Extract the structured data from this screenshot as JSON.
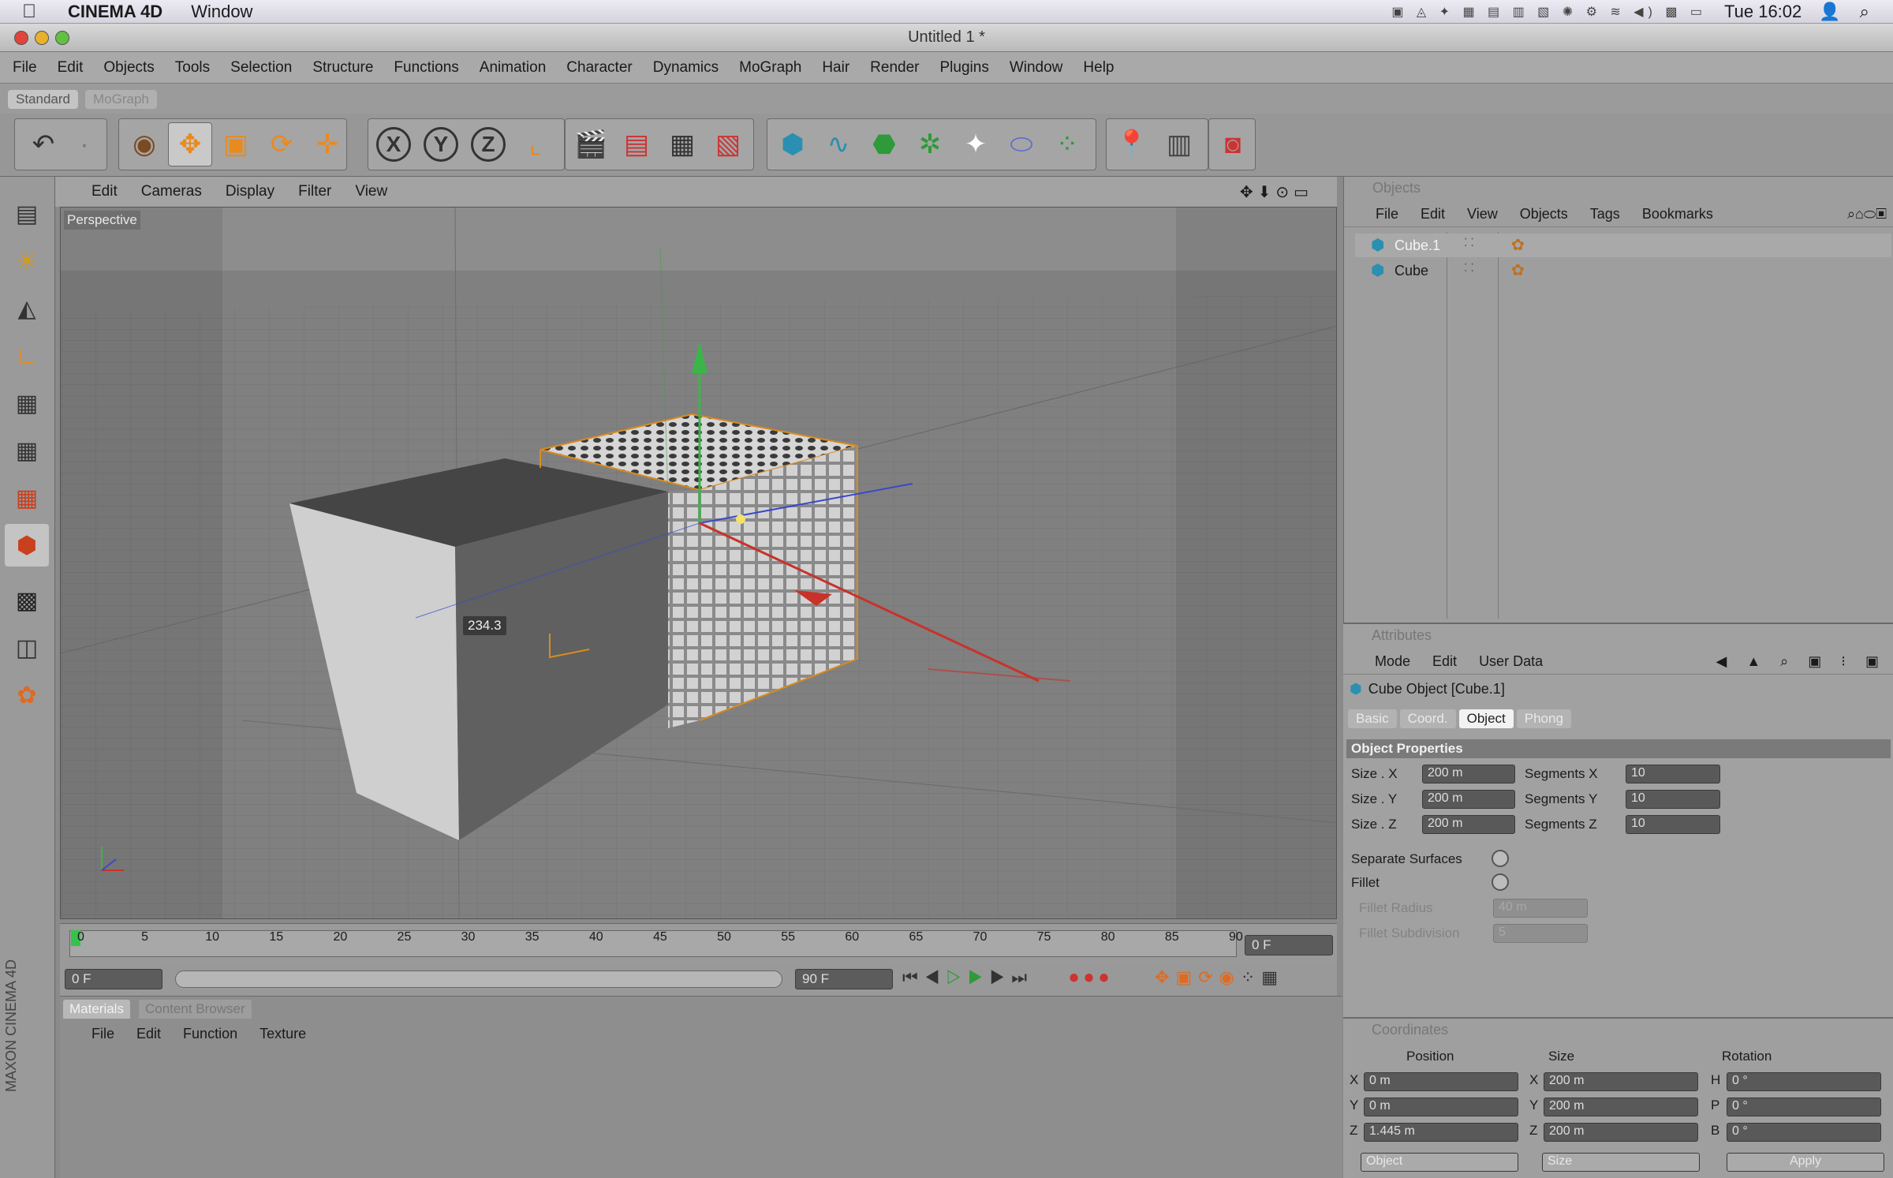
{
  "macbar": {
    "app": "CINEMA 4D",
    "window_menu": "Window",
    "clock": "Tue 16:02",
    "adobe_count": "11"
  },
  "window": {
    "title": "Untitled 1 *"
  },
  "menubar": {
    "items": [
      "File",
      "Edit",
      "Objects",
      "Tools",
      "Selection",
      "Structure",
      "Functions",
      "Animation",
      "Character",
      "Dynamics",
      "MoGraph",
      "Hair",
      "Render",
      "Plugins",
      "Window",
      "Help"
    ]
  },
  "layouts": {
    "standard": "Standard",
    "mograph": "MoGraph"
  },
  "toolbar": {
    "x": "X",
    "y": "Y",
    "z": "Z"
  },
  "viewport": {
    "menu": [
      "Edit",
      "Cameras",
      "Display",
      "Filter",
      "View"
    ],
    "label": "Perspective",
    "hud_value": "234.3"
  },
  "timeline": {
    "ticks": [
      "0",
      "5",
      "10",
      "15",
      "20",
      "25",
      "30",
      "35",
      "40",
      "45",
      "50",
      "55",
      "60",
      "65",
      "70",
      "75",
      "80",
      "85",
      "90"
    ],
    "current": "0 F",
    "start": "0 F",
    "end": "90 F"
  },
  "materials": {
    "tab_materials": "Materials",
    "tab_content": "Content Browser",
    "menu": [
      "File",
      "Edit",
      "Function",
      "Texture"
    ]
  },
  "objects": {
    "title": "Objects",
    "menu": [
      "File",
      "Edit",
      "View",
      "Objects",
      "Tags",
      "Bookmarks"
    ],
    "items": [
      {
        "name": "Cube.1",
        "selected": true
      },
      {
        "name": "Cube",
        "selected": false
      }
    ]
  },
  "attributes": {
    "title": "Attributes",
    "menu": [
      "Mode",
      "Edit",
      "User Data"
    ],
    "object_title": "Cube Object [Cube.1]",
    "tabs": [
      "Basic",
      "Coord.",
      "Object",
      "Phong"
    ],
    "active_tab": "Object",
    "section": "Object Properties",
    "size_labels": [
      "Size . X",
      "Size . Y",
      "Size . Z"
    ],
    "size_values": [
      "200 m",
      "200 m",
      "200 m"
    ],
    "seg_labels": [
      "Segments X",
      "Segments Y",
      "Segments Z"
    ],
    "seg_values": [
      "10",
      "10",
      "10"
    ],
    "separate_surfaces": "Separate Surfaces",
    "fillet": "Fillet",
    "fillet_radius": "Fillet Radius",
    "fillet_radius_value": "40 m",
    "fillet_subdivision": "Fillet Subdivision",
    "fillet_subdivision_value": "5"
  },
  "coordinates": {
    "title": "Coordinates",
    "headers": [
      "Position",
      "Size",
      "Rotation"
    ],
    "axes": [
      "X",
      "Y",
      "Z"
    ],
    "rot_axes": [
      "H",
      "P",
      "B"
    ],
    "position": [
      "0 m",
      "0 m",
      "1.445 m"
    ],
    "size": [
      "200 m",
      "200 m",
      "200 m"
    ],
    "rotation": [
      "0 °",
      "0 °",
      "0 °"
    ],
    "mode1": "Object",
    "mode2": "Size",
    "apply": "Apply"
  },
  "colors": {
    "accent": "#e98a1e",
    "x_axis": "#c8322a",
    "y_axis": "#3bb54a",
    "z_axis": "#3a48c9"
  }
}
